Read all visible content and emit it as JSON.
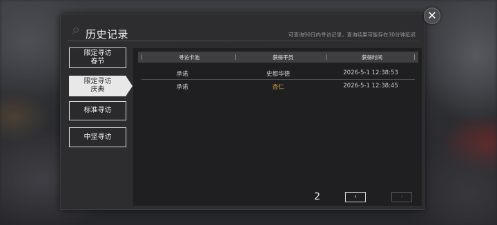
{
  "dialog": {
    "title": "历史记录",
    "hint": "可查询90日内寻访记录，查询结果可能存在30分钟延迟",
    "close_icon": "✕"
  },
  "sidebar": {
    "items": [
      {
        "line1": "限定寻访",
        "line2": "春节",
        "active": false
      },
      {
        "line1": "限定寻访",
        "line2": "庆典",
        "active": true
      },
      {
        "line1": "标准寻访",
        "line2": "",
        "active": false
      },
      {
        "line1": "中坚寻访",
        "line2": "",
        "active": false
      }
    ]
  },
  "table": {
    "headers": [
      "寻访卡池",
      "获得干员",
      "获得时间"
    ],
    "rows": [
      {
        "pool": "承诺",
        "operator": "史都华德",
        "time": "2026-5-1 12:38:53",
        "highlight": false
      },
      {
        "pool": "承诺",
        "operator": "杏仁",
        "time": "2026-5-1 12:38:45",
        "highlight": true
      }
    ]
  },
  "pager": {
    "prev_icon": "‹",
    "next_icon": "›",
    "page": "2"
  },
  "colors": {
    "accent_gold": "#e5a74a",
    "panel": "#1f1f21"
  }
}
